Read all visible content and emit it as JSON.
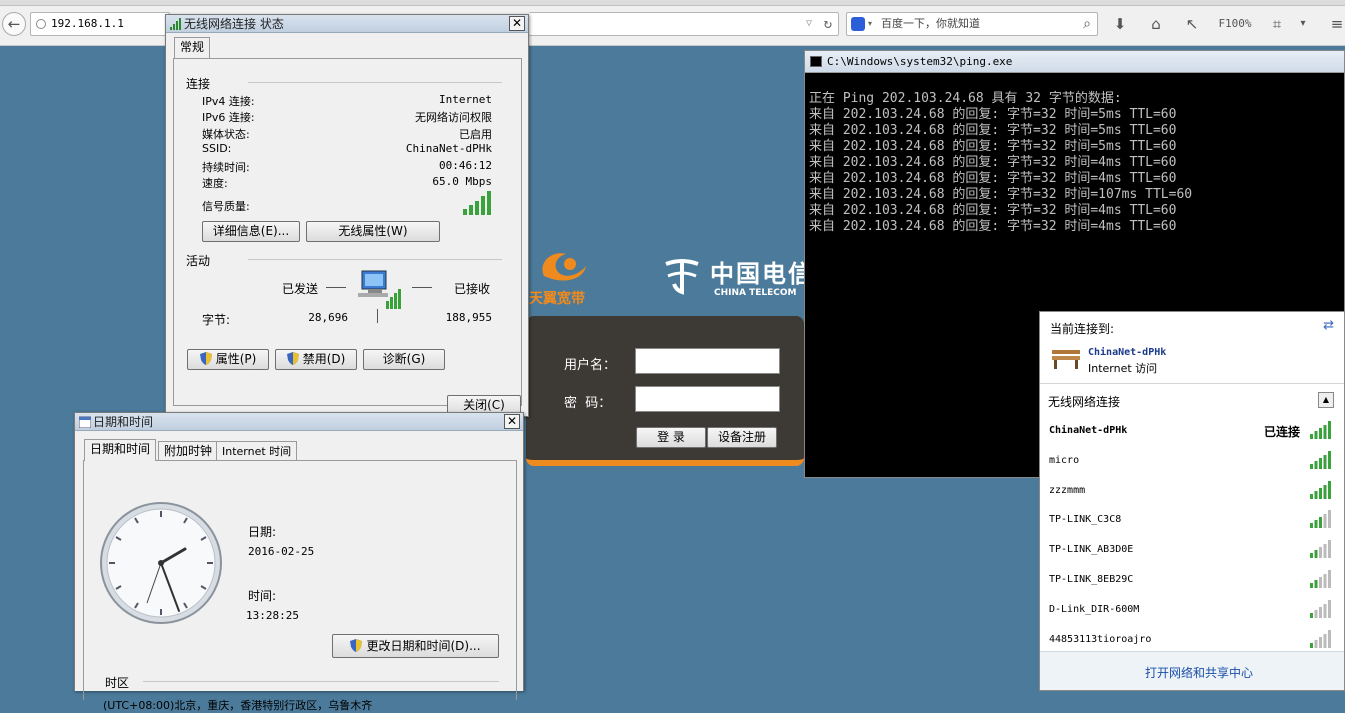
{
  "browser": {
    "address": "192.168.1.1",
    "search_placeholder": "百度一下，你就知道",
    "zoom": "F100%"
  },
  "router_page": {
    "brand_cn": "天翼宽带",
    "telecom_cn": "中国电信",
    "telecom_en": "CHINA TELECOM",
    "username_label": "用户名：",
    "password_label": "密  码：",
    "login_button": "登 录",
    "register_button": "设备注册"
  },
  "status_dialog": {
    "title": "无线网络连接 状态",
    "tab": "常规",
    "section_connection": "连接",
    "rows": [
      {
        "label": "IPv4 连接:",
        "value": "Internet"
      },
      {
        "label": "IPv6 连接:",
        "value": "无网络访问权限"
      },
      {
        "label": "媒体状态:",
        "value": "已启用"
      },
      {
        "label": "SSID:",
        "value": "ChinaNet-dPHk"
      },
      {
        "label": "持续时间:",
        "value": "00:46:12"
      },
      {
        "label": "速度:",
        "value": "65.0 Mbps"
      }
    ],
    "signal_label": "信号质量:",
    "details_button": "详细信息(E)...",
    "wireless_props_button": "无线属性(W)",
    "section_activity": "活动",
    "sent_label": "已发送",
    "received_label": "已接收",
    "bytes_label": "字节:",
    "bytes_sent": "28,696",
    "bytes_received": "188,955",
    "properties_button": "属性(P)",
    "disable_button": "禁用(D)",
    "diagnose_button": "诊断(G)",
    "close_button": "关闭(C)"
  },
  "datetime_dialog": {
    "title": "日期和时间",
    "tabs": [
      "日期和时间",
      "附加时钟",
      "Internet 时间"
    ],
    "date_label": "日期:",
    "date_value": "2016-02-25",
    "time_label": "时间:",
    "time_value": "13:28:25",
    "change_button": "更改日期和时间(D)...",
    "timezone_label": "时区",
    "timezone_value": "(UTC+08:00)北京，重庆，香港特别行政区，乌鲁木齐"
  },
  "cmd": {
    "title": "C:\\Windows\\system32\\ping.exe",
    "lines": [
      "正在 Ping 202.103.24.68 具有 32 字节的数据:",
      "来自 202.103.24.68 的回复: 字节=32 时间=5ms TTL=60",
      "来自 202.103.24.68 的回复: 字节=32 时间=5ms TTL=60",
      "来自 202.103.24.68 的回复: 字节=32 时间=5ms TTL=60",
      "来自 202.103.24.68 的回复: 字节=32 时间=4ms TTL=60",
      "来自 202.103.24.68 的回复: 字节=32 时间=4ms TTL=60",
      "来自 202.103.24.68 的回复: 字节=32 时间=107ms TTL=60",
      "来自 202.103.24.68 的回复: 字节=32 时间=4ms TTL=60",
      "来自 202.103.24.68 的回复: 字节=32 时间=4ms TTL=60"
    ]
  },
  "wifi_popup": {
    "current_label": "当前连接到:",
    "current_network": "ChinaNet-dPHk",
    "current_access": "Internet 访问",
    "section_label": "无线网络连接",
    "connected_network": "ChinaNet-dPHk",
    "connected_status": "已连接",
    "networks": [
      "micro",
      "zzzmmm",
      "TP-LINK_C3C8",
      "TP-LINK_AB3D0E",
      "TP-LINK_8EB29C",
      "D-Link_DIR-600M",
      "44853113tioroajro"
    ],
    "footer_link": "打开网络和共享中心"
  }
}
